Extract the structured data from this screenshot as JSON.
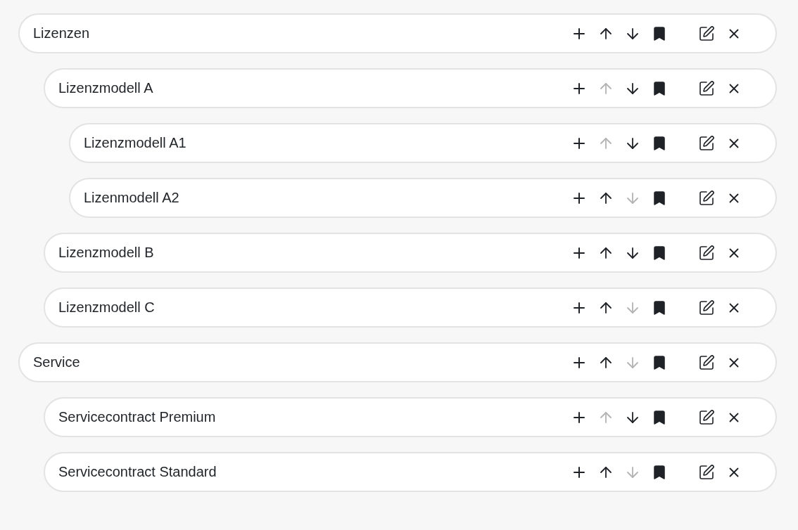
{
  "tree": [
    {
      "label": "Lizenzen",
      "up_disabled": false,
      "down_disabled": false,
      "children": [
        {
          "label": "Lizenzmodell A",
          "up_disabled": true,
          "down_disabled": false,
          "children": [
            {
              "label": "Lizenzmodell A1",
              "up_disabled": true,
              "down_disabled": false
            },
            {
              "label": "Lizenmodell A2",
              "up_disabled": false,
              "down_disabled": true
            }
          ]
        },
        {
          "label": "Lizenzmodell B",
          "up_disabled": false,
          "down_disabled": false
        },
        {
          "label": "Lizenzmodell C",
          "up_disabled": false,
          "down_disabled": true
        }
      ]
    },
    {
      "label": "Service",
      "up_disabled": false,
      "down_disabled": true,
      "children": [
        {
          "label": "Servicecontract Premium",
          "up_disabled": true,
          "down_disabled": false
        },
        {
          "label": "Servicecontract Standard",
          "up_disabled": false,
          "down_disabled": true
        }
      ]
    }
  ]
}
